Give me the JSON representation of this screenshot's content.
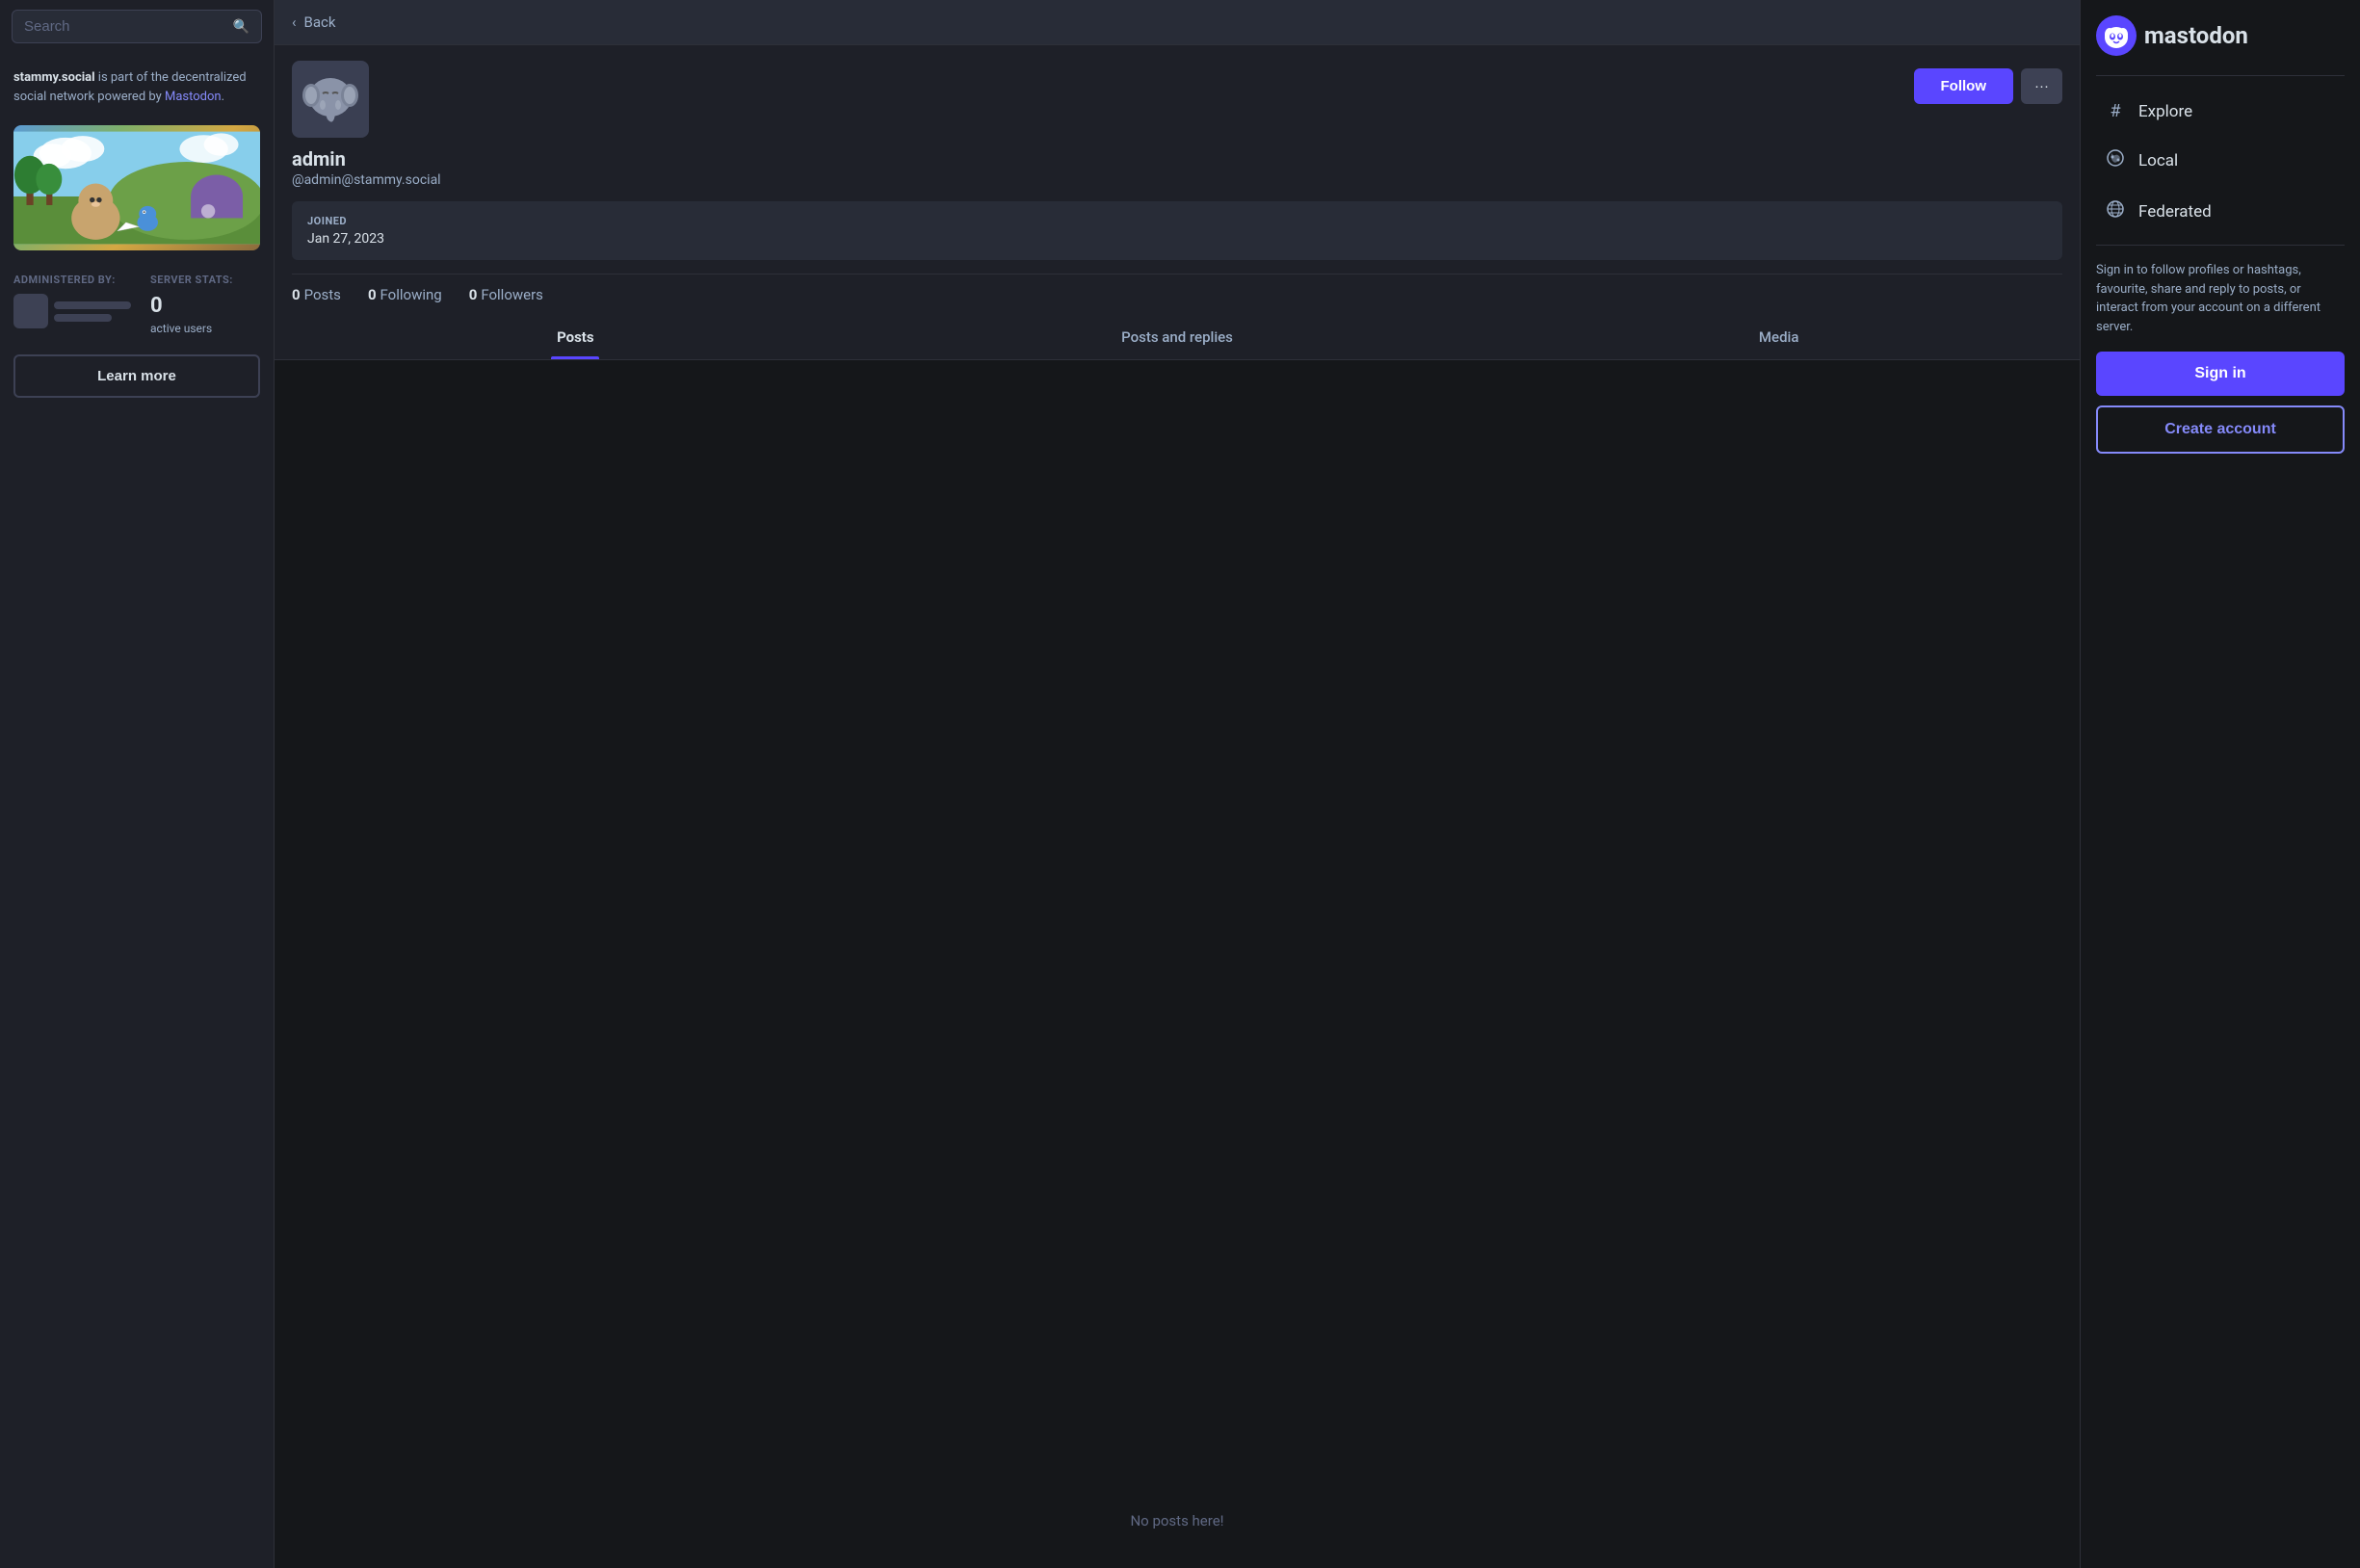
{
  "search": {
    "placeholder": "Search"
  },
  "left_sidebar": {
    "site_name": "stammy.social",
    "site_description": " is part of the decentralized social network powered by ",
    "mastodon_link": "Mastodon",
    "site_description_end": ".",
    "administered_by_label": "ADMINISTERED BY:",
    "server_stats_label": "SERVER STATS:",
    "active_users_count": "0",
    "active_users_label": "active users",
    "learn_more_label": "Learn more"
  },
  "back_bar": {
    "label": "Back"
  },
  "profile": {
    "name": "admin",
    "handle": "@admin@stammy.social",
    "joined_label": "JOINED",
    "joined_date": "Jan 27, 2023",
    "follow_label": "Follow",
    "more_label": "···",
    "posts_count": "0",
    "posts_label": "Posts",
    "following_count": "0",
    "following_label": "Following",
    "followers_count": "0",
    "followers_label": "Followers"
  },
  "tabs": {
    "posts_label": "Posts",
    "posts_replies_label": "Posts and replies",
    "media_label": "Media",
    "active": "posts"
  },
  "empty_state": {
    "message": "No posts here!"
  },
  "right_sidebar": {
    "logo_text": "mastodon",
    "logo_symbol": "m",
    "explore_label": "Explore",
    "local_label": "Local",
    "federated_label": "Federated",
    "sign_in_description": "Sign in to follow profiles or hashtags, favourite, share and reply to posts, or interact from your account on a different server.",
    "sign_in_label": "Sign in",
    "create_account_label": "Create account"
  }
}
